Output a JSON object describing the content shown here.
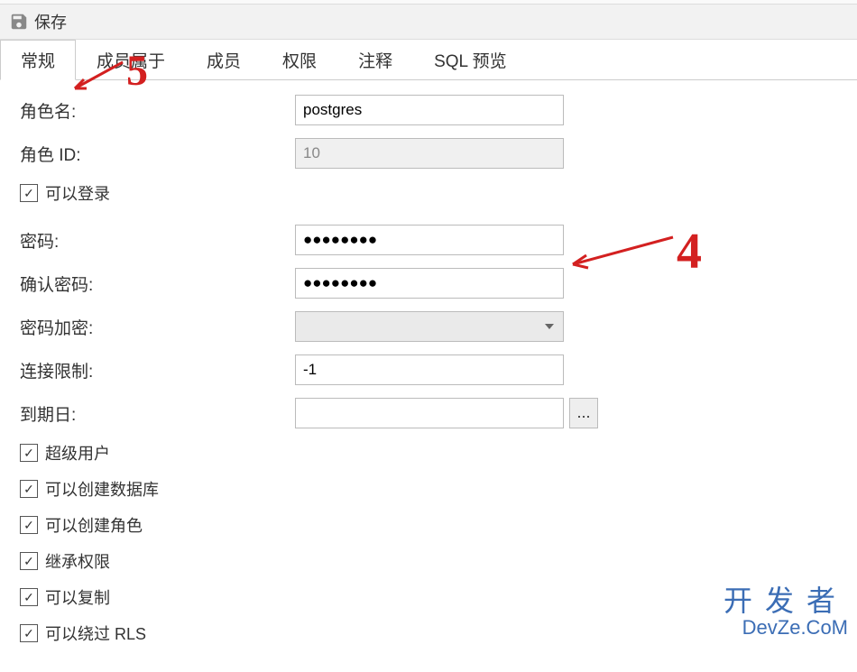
{
  "toolbar": {
    "save_label": "保存"
  },
  "tabs": {
    "general": "常规",
    "member_of": "成员属于",
    "members": "成员",
    "privileges": "权限",
    "comment": "注释",
    "sql_preview": "SQL 预览"
  },
  "form": {
    "role_name_label": "角色名:",
    "role_name_value": "postgres",
    "role_id_label": "角色 ID:",
    "role_id_value": "10",
    "can_login_label": "可以登录",
    "password_label": "密码:",
    "password_value": "●●●●●●●●",
    "confirm_password_label": "确认密码:",
    "confirm_password_value": "●●●●●●●●",
    "password_encryption_label": "密码加密:",
    "password_encryption_value": "",
    "connection_limit_label": "连接限制:",
    "connection_limit_value": "-1",
    "expiry_date_label": "到期日:",
    "expiry_date_value": "",
    "more_button": "...",
    "superuser_label": "超级用户",
    "can_create_db_label": "可以创建数据库",
    "can_create_role_label": "可以创建角色",
    "inherit_label": "继承权限",
    "can_replicate_label": "可以复制",
    "bypass_rls_label": "可以绕过 RLS"
  },
  "annotations": {
    "five": "5",
    "four": "4"
  },
  "watermark": {
    "line1": "开发者",
    "line2": "DevZe.CoM"
  }
}
